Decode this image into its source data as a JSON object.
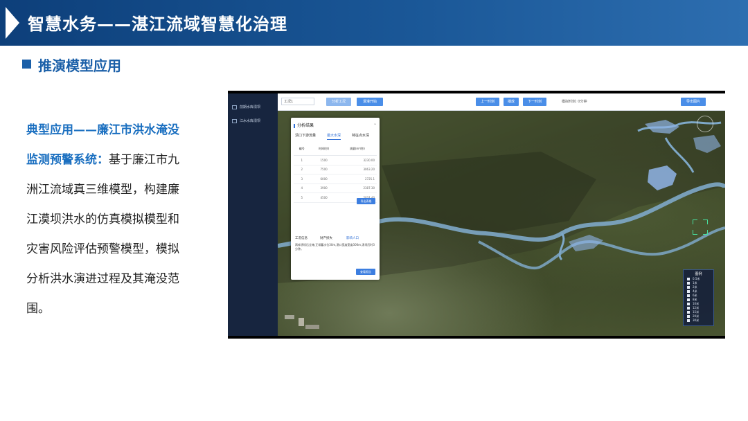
{
  "header": {
    "title": "智慧水务——湛江流域智慧化治理"
  },
  "section": {
    "title": "推演模型应用"
  },
  "description": {
    "highlight": "典型应用——廉江市洪水淹没监测预警系统：",
    "body": "基于廉江市九洲江流域真三维模型，构建廉江漠坝洪水的仿真模拟模型和灾害风险评估预警模型，模拟分析洪水演进过程及其淹没范围。"
  },
  "screen": {
    "sidebar": {
      "items": [
        "前期水库溃坝",
        "江水水库溃坝"
      ]
    },
    "toolbar": {
      "select_value": "工况1",
      "btn_analysis": "分析工况",
      "btn_flood": "漫灌开始",
      "btn_prev": "上一时刻",
      "btn_play": "播放",
      "btn_next": "下一时刻",
      "time_text": "模拟时刻: 0分钟",
      "btn_export": "导出图片"
    },
    "panel": {
      "title": "分析结果",
      "tabs": [
        "溃口下游流量",
        "最大水深",
        "特征点水深"
      ],
      "active_tab": 1,
      "table": {
        "headers": [
          "编号",
          "时间(秒)",
          "流量(m³/秒)"
        ],
        "rows": [
          [
            "1",
            "1500",
            "3230.00"
          ],
          [
            "2",
            "7500",
            "3063.20"
          ],
          [
            "3",
            "6000",
            "2725.1"
          ],
          [
            "4",
            "3900",
            "2387.30"
          ],
          [
            "5",
            "4500",
            "2074.40"
          ]
        ]
      },
      "btn_export_table": "导出表格",
      "info_labels": [
        "工况信息",
        "财产损失",
        "影响人口"
      ],
      "note": "两库溃坝后全淹,正常蓄水位30m,溃口宽度宽度300m,溃坝历时3分钟。",
      "btn_view_report": "查看报告"
    },
    "legend": {
      "title": "图例",
      "items": [
        "0.5米",
        "1米",
        "2米",
        "4米",
        "6米",
        "8米",
        "10米",
        "12米",
        "15米",
        "20米",
        "30米"
      ]
    },
    "colors": {
      "water": "#8fb4e6",
      "river": "#7ea8c8",
      "button": "#4a8ee8",
      "sidebar": "#17253f"
    }
  }
}
